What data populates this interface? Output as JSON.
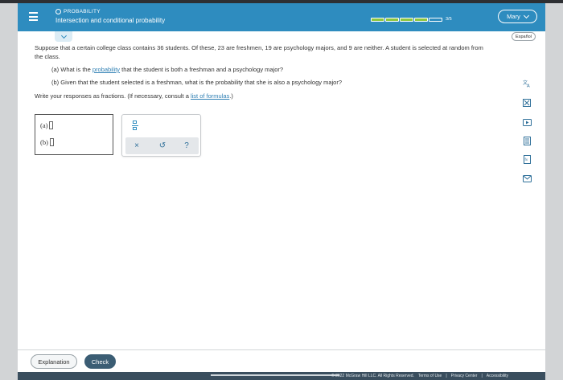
{
  "header": {
    "topic": "PROBABILITY",
    "title": "Intersection and conditional probability",
    "progress_label": "3/5",
    "progress_fraction": 0.6,
    "user_name": "Mary"
  },
  "lang_button": "Español",
  "problem": {
    "intro": "Suppose that a certain college class contains 36 students. Of these, 23 are freshmen, 19 are psychology majors, and 9 are neither. A student is selected at random from the class.",
    "part_a_pre": "(a) What is the ",
    "part_a_link": "probability",
    "part_a_post": " that the student is both a freshman and a psychology major?",
    "part_b": "(b) Given that the student selected is a freshman, what is the probability that she is also a psychology major?",
    "instr_pre": "Write your responses as fractions. (If necessary, consult a ",
    "instr_link": "list of formulas",
    "instr_post": ".)"
  },
  "answers": {
    "a_label": "(a)",
    "b_label": "(b)"
  },
  "toolbar": {
    "clear": "×",
    "undo": "↺",
    "help": "?"
  },
  "sidebar_icons": [
    "translate-icon",
    "calculator-icon",
    "video-icon",
    "textbook-icon",
    "formula-icon",
    "mail-icon"
  ],
  "footer": {
    "explanation": "Explanation",
    "check": "Check",
    "copyright": "© 2022 McGraw Hill LLC. All Rights Reserved.",
    "terms": "Terms of Use",
    "privacy": "Privacy Center",
    "accessibility": "Accessibility"
  },
  "colors": {
    "header_bg": "#2e8cbf",
    "progress_green": "#8fc63f",
    "check_bg": "#3b5d74"
  }
}
